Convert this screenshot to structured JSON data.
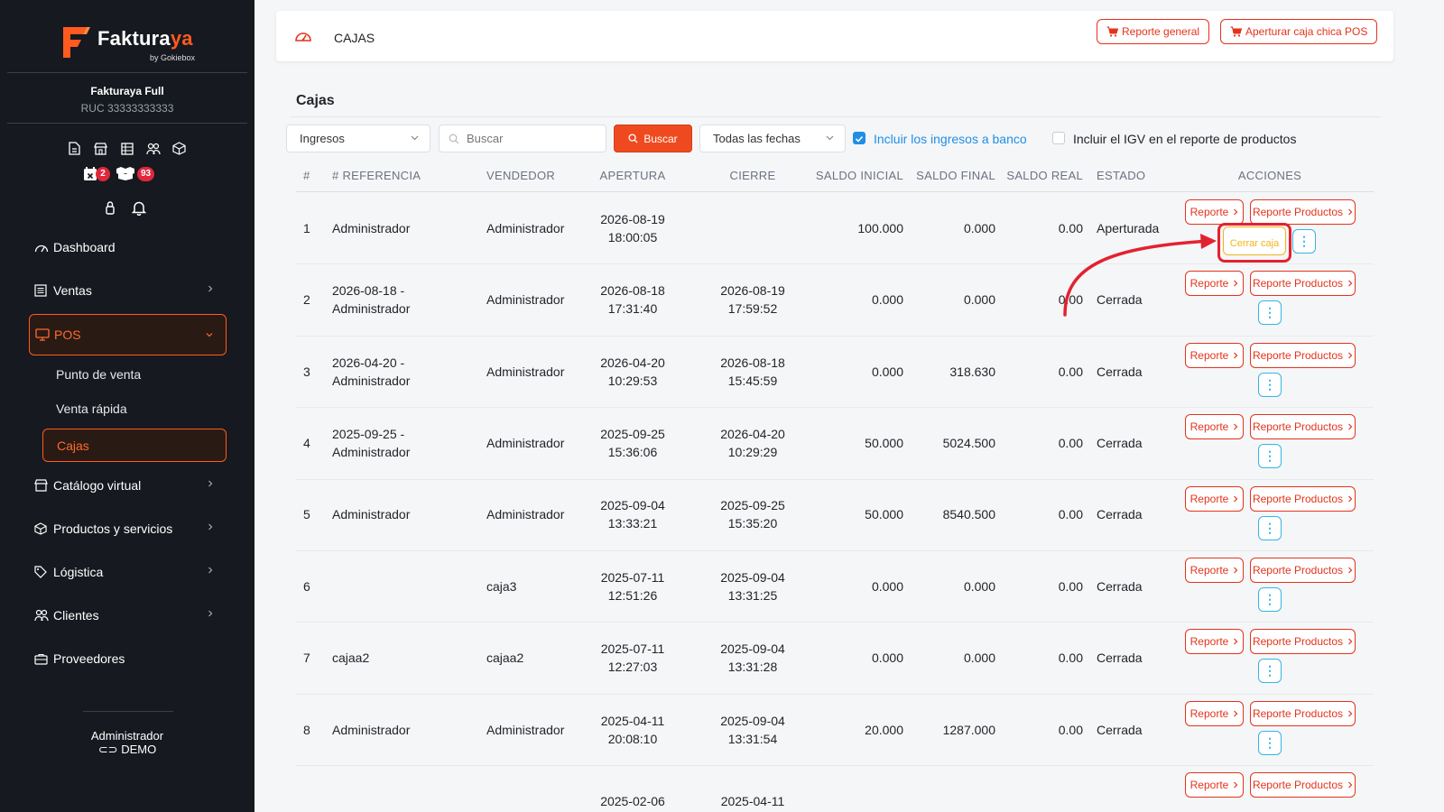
{
  "brand": {
    "name_main": "Faktura",
    "name_accent": "ya",
    "sub": "by Gokiebox"
  },
  "company": {
    "name": "Fakturaya Full",
    "ruc": "RUC 33333333333"
  },
  "badges": {
    "calendar": "2",
    "boxes": "93"
  },
  "menu": {
    "dashboard": "Dashboard",
    "ventas": "Ventas",
    "pos": "POS",
    "pos_sub": [
      "Punto de venta",
      "Venta rápida",
      "Cajas"
    ],
    "catalogo": "Catálogo virtual",
    "productos": "Productos y servicios",
    "logistica": "Lógistica",
    "clientes": "Clientes",
    "proveedores": "Proveedores"
  },
  "user": {
    "name": "Administrador",
    "role": "DEMO"
  },
  "topbar": {
    "breadcrumb": "CAJAS",
    "btn_reporte_general": "Reporte general",
    "btn_apertura": "Aperturar caja chica POS"
  },
  "page": {
    "title": "Cajas"
  },
  "filters": {
    "tipo": "Ingresos",
    "search_placeholder": "Buscar",
    "search_btn": "Buscar",
    "fechas": "Todas las fechas",
    "check_bank": "Incluir los ingresos a banco",
    "check_igv": "Incluir el IGV en el reporte de productos"
  },
  "table": {
    "headers": [
      "#",
      "# REFERENCIA",
      "VENDEDOR",
      "APERTURA",
      "CIERRE",
      "SALDO INICIAL",
      "SALDO FINAL",
      "SALDO REAL",
      "ESTADO",
      "ACCIONES"
    ],
    "rows": [
      {
        "n": "1",
        "ref1": "Administrador",
        "ref2": "",
        "vend": "Administrador",
        "ap1": "2026-08-19",
        "ap2": "18:00:05",
        "ci1": "",
        "ci2": "",
        "si": "100.000",
        "sf": "0.000",
        "sr": "0.00",
        "est": "Aperturada"
      },
      {
        "n": "2",
        "ref1": "2026-08-18 -",
        "ref2": "Administrador",
        "vend": "Administrador",
        "ap1": "2026-08-18",
        "ap2": "17:31:40",
        "ci1": "2026-08-19",
        "ci2": "17:59:52",
        "si": "0.000",
        "sf": "0.000",
        "sr": "0.00",
        "est": "Cerrada"
      },
      {
        "n": "3",
        "ref1": "2026-04-20 -",
        "ref2": "Administrador",
        "vend": "Administrador",
        "ap1": "2026-04-20",
        "ap2": "10:29:53",
        "ci1": "2026-08-18",
        "ci2": "15:45:59",
        "si": "0.000",
        "sf": "318.630",
        "sr": "0.00",
        "est": "Cerrada"
      },
      {
        "n": "4",
        "ref1": "2025-09-25 -",
        "ref2": "Administrador",
        "vend": "Administrador",
        "ap1": "2025-09-25",
        "ap2": "15:36:06",
        "ci1": "2026-04-20",
        "ci2": "10:29:29",
        "si": "50.000",
        "sf": "5024.500",
        "sr": "0.00",
        "est": "Cerrada"
      },
      {
        "n": "5",
        "ref1": "Administrador",
        "ref2": "",
        "vend": "Administrador",
        "ap1": "2025-09-04",
        "ap2": "13:33:21",
        "ci1": "2025-09-25",
        "ci2": "15:35:20",
        "si": "50.000",
        "sf": "8540.500",
        "sr": "0.00",
        "est": "Cerrada"
      },
      {
        "n": "6",
        "ref1": "",
        "ref2": "",
        "vend": "caja3",
        "ap1": "2025-07-11",
        "ap2": "12:51:26",
        "ci1": "2025-09-04",
        "ci2": "13:31:25",
        "si": "0.000",
        "sf": "0.000",
        "sr": "0.00",
        "est": "Cerrada"
      },
      {
        "n": "7",
        "ref1": "cajaa2",
        "ref2": "",
        "vend": "cajaa2",
        "ap1": "2025-07-11",
        "ap2": "12:27:03",
        "ci1": "2025-09-04",
        "ci2": "13:31:28",
        "si": "0.000",
        "sf": "0.000",
        "sr": "0.00",
        "est": "Cerrada"
      },
      {
        "n": "8",
        "ref1": "Administrador",
        "ref2": "",
        "vend": "Administrador",
        "ap1": "2025-04-11",
        "ap2": "20:08:10",
        "ci1": "2025-09-04",
        "ci2": "13:31:54",
        "si": "20.000",
        "sf": "1287.000",
        "sr": "0.00",
        "est": "Cerrada"
      },
      {
        "n": "",
        "ref1": "",
        "ref2": "",
        "vend": "",
        "ap1": "2025-02-06",
        "ap2": "",
        "ci1": "2025-04-11",
        "ci2": "",
        "si": "",
        "sf": "",
        "sr": "",
        "est": ""
      }
    ],
    "action_reporte": "Reporte",
    "action_reporte_productos": "Reporte Productos",
    "action_cerrar": "Cerrar caja",
    "action_more": "⋮"
  },
  "colors": {
    "accent": "#e4331c",
    "sidebar": "#16191f",
    "highlight": "#e3222f",
    "warning": "#f1b51a",
    "info": "#34b5e6"
  }
}
